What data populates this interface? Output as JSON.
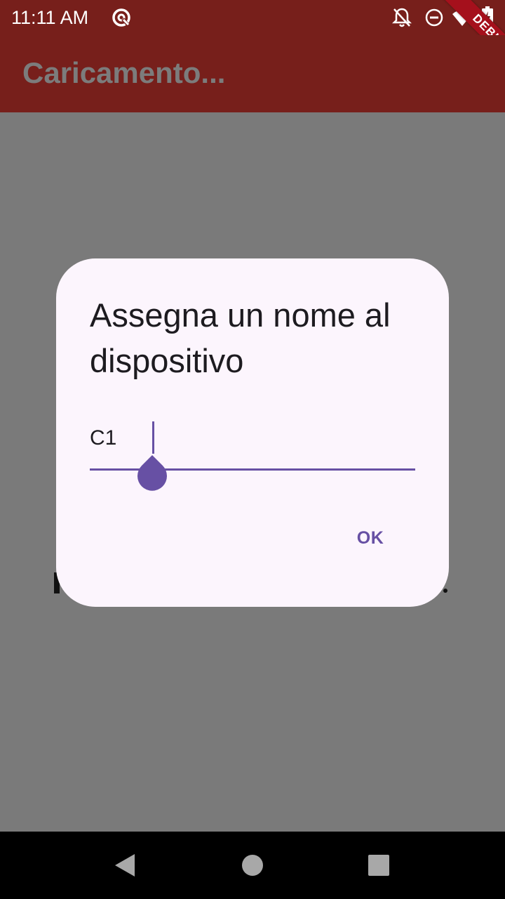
{
  "status_bar": {
    "time": "11:11 AM",
    "icons": [
      "sync-icon",
      "notifications-off-icon",
      "do-not-disturb-icon",
      "wifi-icon",
      "battery-charging-icon"
    ]
  },
  "debug_banner": {
    "label": "DEBUG"
  },
  "app_bar": {
    "title": "Caricamento..."
  },
  "dialog": {
    "title": "Assegna un nome al dispositivo",
    "input_value": "C1",
    "ok_label": "OK"
  },
  "colors": {
    "app_bar": "#771f1b",
    "scrim_background": "#7a7a7a",
    "dialog_surface": "#fcf5fd",
    "accent": "#6750a4",
    "debug_ribbon": "#a5101c"
  },
  "nav_bar": {
    "icons": [
      "back-icon",
      "home-icon",
      "recents-icon"
    ]
  }
}
